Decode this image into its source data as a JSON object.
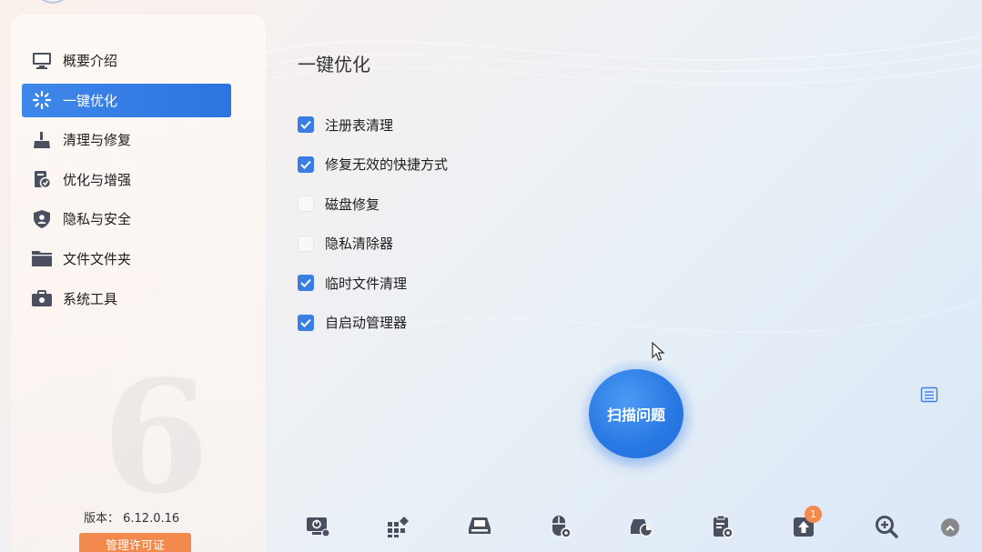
{
  "sidebar": {
    "items": [
      {
        "label": "概要介绍",
        "icon": "monitor-icon",
        "active": false
      },
      {
        "label": "一键优化",
        "icon": "sparkle-icon",
        "active": true
      },
      {
        "label": "清理与修复",
        "icon": "broom-icon",
        "active": false
      },
      {
        "label": "优化与增强",
        "icon": "boost-icon",
        "active": false
      },
      {
        "label": "隐私与安全",
        "icon": "shield-icon",
        "active": false
      },
      {
        "label": "文件文件夹",
        "icon": "folder-icon",
        "active": false
      },
      {
        "label": "系统工具",
        "icon": "toolbox-icon",
        "active": false
      }
    ],
    "background_digit": "6",
    "version_text": "版本： 6.12.0.16",
    "license_button": "管理许可证"
  },
  "main": {
    "title": "一键优化",
    "options": [
      {
        "label": "注册表清理",
        "checked": true
      },
      {
        "label": "修复无效的快捷方式",
        "checked": true
      },
      {
        "label": "磁盘修复",
        "checked": false
      },
      {
        "label": "隐私清除器",
        "checked": false
      },
      {
        "label": "临时文件清理",
        "checked": true
      },
      {
        "label": "自启动管理器",
        "checked": true
      }
    ],
    "scan_button": "扫描问题"
  },
  "toolbar": {
    "items": [
      {
        "icon": "power-monitor-icon"
      },
      {
        "icon": "apps-grid-icon"
      },
      {
        "icon": "disk-icon"
      },
      {
        "icon": "mouse-gear-icon"
      },
      {
        "icon": "disk-pie-icon"
      },
      {
        "icon": "clipboard-gear-icon"
      },
      {
        "icon": "upgrade-icon",
        "badge": "1"
      },
      {
        "icon": "zoom-in-icon"
      }
    ]
  },
  "colors": {
    "accent": "#2d74e0",
    "license": "#f28a4d",
    "icon_gray": "#4a5060"
  }
}
